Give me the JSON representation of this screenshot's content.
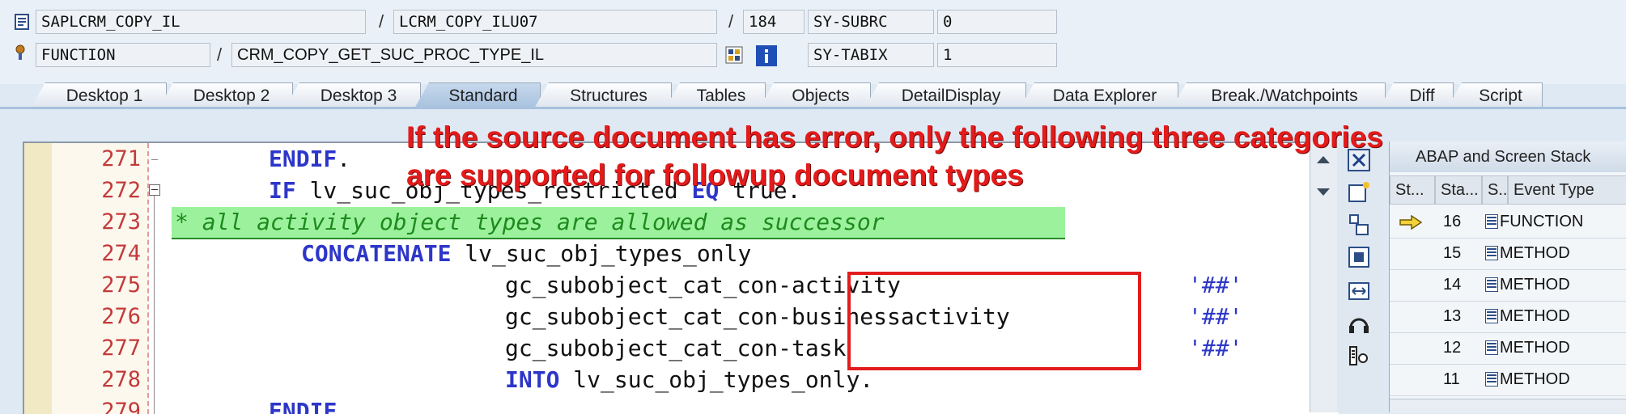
{
  "header": {
    "row1": {
      "program": "SAPLCRM_COPY_IL",
      "include": "LCRM_COPY_ILU07",
      "line": "184",
      "sysvar": "SY-SUBRC",
      "sysval": "0"
    },
    "row2": {
      "type": "FUNCTION",
      "name": "CRM_COPY_GET_SUC_PROC_TYPE_IL",
      "sysvar": "SY-TABIX",
      "sysval": "1"
    },
    "slash": "/"
  },
  "tabs": [
    "Desktop 1",
    "Desktop 2",
    "Desktop 3",
    "Standard",
    "Structures",
    "Tables",
    "Objects",
    "DetailDisplay",
    "Data Explorer",
    "Break./Watchpoints",
    "Diff",
    "Script"
  ],
  "active_tab": "Standard",
  "code": {
    "lines": [
      {
        "num": "271",
        "kw1": "ENDIF",
        "rest": "."
      },
      {
        "num": "272",
        "kw1": "IF",
        "rest": " lv_suc_obj_types_restricted ",
        "kw2": "EQ",
        "rest2": " true."
      },
      {
        "num": "273",
        "comment": "* all activity object types are allowed as successor"
      },
      {
        "num": "274",
        "kw1": "CONCATENATE",
        "rest": " lv_suc_obj_types_only"
      },
      {
        "num": "275",
        "text": "gc_subobject_cat_con-activity",
        "str": "'##'"
      },
      {
        "num": "276",
        "text": "gc_subobject_cat_con-businessactivity",
        "str": "'##'"
      },
      {
        "num": "277",
        "text": "gc_subobject_cat_con-task",
        "str": "'##'"
      },
      {
        "num": "278",
        "kw1": "INTO",
        "rest": " lv_suc_obj_types_only."
      },
      {
        "num": "279",
        "kw1": "ENDIF",
        "rest": "."
      }
    ]
  },
  "annotation": {
    "line1": "If the source document has error, only the following three categories",
    "line2": "are supported for followup document types",
    "color": "#e31b1b"
  },
  "stack": {
    "title": "ABAP and Screen Stack",
    "columns": [
      "St...",
      "Sta...",
      "S...",
      "Event Type"
    ],
    "rows": [
      {
        "level": "16",
        "type": "FUNCTION",
        "current": true
      },
      {
        "level": "15",
        "type": "METHOD",
        "current": false
      },
      {
        "level": "14",
        "type": "METHOD",
        "current": false
      },
      {
        "level": "13",
        "type": "METHOD",
        "current": false
      },
      {
        "level": "12",
        "type": "METHOD",
        "current": false
      },
      {
        "level": "11",
        "type": "METHOD",
        "current": false
      }
    ]
  },
  "icons": {
    "program_icon": "program-icon",
    "function_icon": "function-module-icon",
    "pattern_icon": "pattern-icon",
    "info_icon": "info-icon",
    "close": "close-icon",
    "new_tool": "new-tool-icon",
    "split": "split-icon",
    "fullscreen": "fullscreen-icon",
    "resize": "resize-icon",
    "headset": "headset-icon",
    "settings": "settings-icon",
    "current_arrow": "current-arrow-icon"
  }
}
